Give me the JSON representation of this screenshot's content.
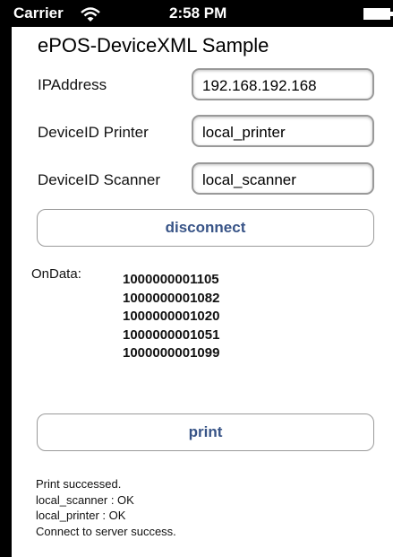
{
  "status_bar": {
    "carrier": "Carrier",
    "time": "2:58 PM",
    "wifi_icon": "wifi-icon",
    "battery_icon": "battery-icon"
  },
  "app": {
    "title": "ePOS-DeviceXML Sample"
  },
  "form": {
    "ip_label": "IPAddress",
    "ip_value": "192.168.192.168",
    "printer_label": "DeviceID Printer",
    "printer_value": "local_printer",
    "scanner_label": "DeviceID Scanner",
    "scanner_value": "local_scanner"
  },
  "buttons": {
    "disconnect": "disconnect",
    "print": "print"
  },
  "ondata": {
    "label": "OnData:",
    "values": [
      "1000000001105",
      "1000000001082",
      "1000000001020",
      "1000000001051",
      "1000000001099"
    ]
  },
  "log": {
    "lines": [
      "Print successed.",
      "local_scanner : OK",
      "local_printer : OK",
      "Connect to server success."
    ]
  },
  "colors": {
    "button_text": "#385487",
    "status_bar": "#000000"
  }
}
